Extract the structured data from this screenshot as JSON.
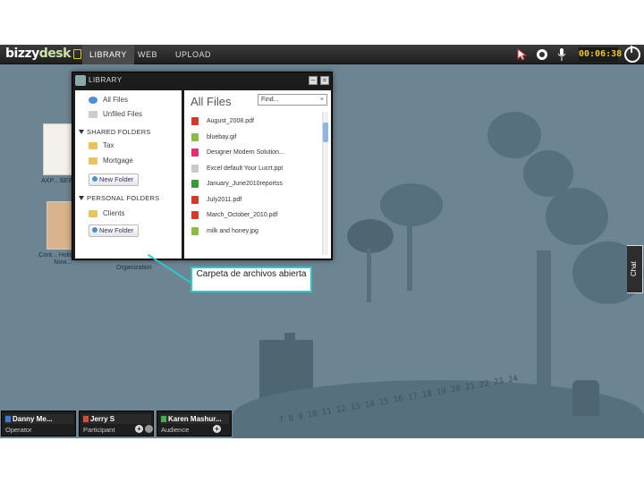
{
  "topbar": {
    "logo_main": "bizzy",
    "logo_accent": "desk",
    "nav": [
      "LIBRARY",
      "WEB",
      "UPLOAD"
    ],
    "timer": "00:06:38"
  },
  "desktop": {
    "items": [
      {
        "label": "AXP... BEWN..."
      },
      {
        "label": "Cont... Holidays - Now..."
      },
      {
        "label": "Organization"
      }
    ]
  },
  "library": {
    "title": "LIBRARY",
    "left": {
      "top_items": [
        "All Files",
        "Unfiled Files"
      ],
      "shared_header": "SHARED FOLDERS",
      "shared_items": [
        "Tax",
        "Mortgage"
      ],
      "new_folder": "New Folder",
      "personal_header": "PERSONAL FOLDERS",
      "personal_items": [
        "Clients"
      ]
    },
    "right": {
      "title": "All Files",
      "find_placeholder": "Find...",
      "files": [
        {
          "name": "August_2008.pdf",
          "icon": "pdf-icon",
          "color": "#d23b2b"
        },
        {
          "name": "bluebay.gif",
          "icon": "image-icon",
          "color": "#8dbb4a"
        },
        {
          "name": "Designer Modern Solution...",
          "icon": "flickr-icon",
          "color": "#e0307a"
        },
        {
          "name": "Excel default Your Lucrt.ppt",
          "icon": "ppt-icon",
          "color": "#c9c9c9"
        },
        {
          "name": "January_June2010reportss",
          "icon": "excel-icon",
          "color": "#3a9a3a"
        },
        {
          "name": "July2011.pdf",
          "icon": "pdf-icon",
          "color": "#d23b2b"
        },
        {
          "name": "March_October_2010.pdf",
          "icon": "pdf-icon",
          "color": "#d23b2b"
        },
        {
          "name": "milk and honey.jpg",
          "icon": "image-icon",
          "color": "#8dbb4a"
        }
      ]
    }
  },
  "callout": {
    "text": "Carpeta de archivos abierta"
  },
  "chat_tab": "Chat",
  "participants": [
    {
      "name": "Danny Me...",
      "role": "Operator",
      "color": "#3a7bd5"
    },
    {
      "name": "Jerry S",
      "role": "Participant",
      "color": "#d9493a"
    },
    {
      "name": "Karen Mashur...",
      "role": "Audience",
      "color": "#3fb04a"
    }
  ],
  "timeline_numbers": "7 8 9 10 11 12 13 14 15 16 17 18 19 20 21 22 23 24"
}
